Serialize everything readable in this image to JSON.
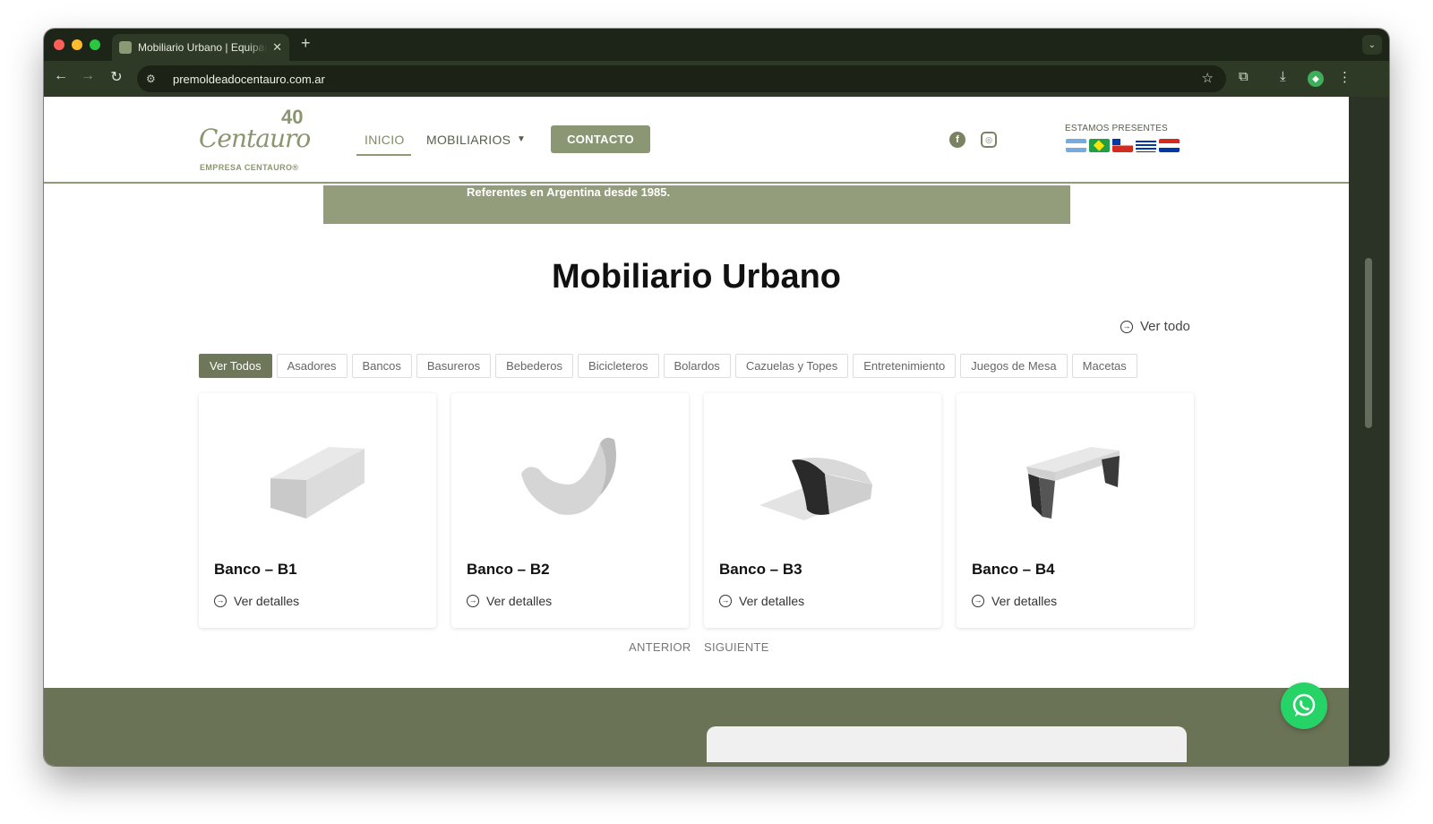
{
  "browser": {
    "tab_title": "Mobiliario Urbano | Equipamiento",
    "tab_close": "✕",
    "new_tab": "+",
    "url": "premoldeadocentauro.com.ar",
    "icons": [
      "back-icon",
      "forward-icon",
      "reload-icon",
      "site-info-icon",
      "star-icon",
      "extensions-icon",
      "download-icon",
      "profile-icon",
      "menu-icon"
    ]
  },
  "header": {
    "logo_script": "Centauro",
    "logo_number": "40",
    "logo_subtitle": "EMPRESA CENTAURO®",
    "nav": {
      "inicio": "INICIO",
      "mobiliarios": "MOBILIARIOS",
      "contacto": "CONTACTO"
    },
    "presentes": "ESTAMOS PRESENTES",
    "flags": [
      "Argentina",
      "Brasil",
      "Chile",
      "Uruguay",
      "Paraguay"
    ]
  },
  "band": {
    "text": "Referentes en Argentina desde 1985."
  },
  "main": {
    "title": "Mobiliario Urbano",
    "ver_todo": "Ver todo",
    "filters": [
      "Ver Todos",
      "Asadores",
      "Bancos",
      "Basureros",
      "Bebederos",
      "Bicicleteros",
      "Bolardos",
      "Cazuelas y Topes",
      "Entretenimiento",
      "Juegos de Mesa",
      "Macetas"
    ],
    "products": [
      {
        "title": "Banco – B1",
        "link": "Ver detalles"
      },
      {
        "title": "Banco – B2",
        "link": "Ver detalles"
      },
      {
        "title": "Banco – B3",
        "link": "Ver detalles"
      },
      {
        "title": "Banco – B4",
        "link": "Ver detalles"
      }
    ],
    "pager": {
      "prev": "ANTERIOR",
      "next": "SIGUIENTE"
    }
  },
  "colors": {
    "brand_green": "#8b9774",
    "footer_green": "#6b7356",
    "whatsapp": "#25d366"
  }
}
